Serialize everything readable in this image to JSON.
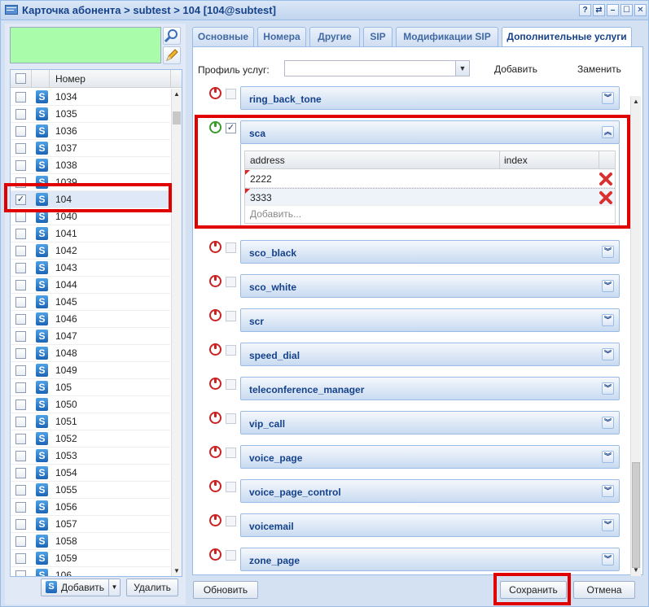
{
  "window": {
    "title": "Карточка абонента > subtest > 104 [104@subtest]",
    "controls": [
      "?",
      "⇄",
      "–",
      "☐",
      "✕"
    ]
  },
  "left": {
    "header_label": "Номер",
    "rows": [
      {
        "num": "1034",
        "checked": false
      },
      {
        "num": "1035",
        "checked": false
      },
      {
        "num": "1036",
        "checked": false
      },
      {
        "num": "1037",
        "checked": false
      },
      {
        "num": "1038",
        "checked": false
      },
      {
        "num": "1039",
        "checked": false
      },
      {
        "num": "104",
        "checked": true
      },
      {
        "num": "1040",
        "checked": false
      },
      {
        "num": "1041",
        "checked": false
      },
      {
        "num": "1042",
        "checked": false
      },
      {
        "num": "1043",
        "checked": false
      },
      {
        "num": "1044",
        "checked": false
      },
      {
        "num": "1045",
        "checked": false
      },
      {
        "num": "1046",
        "checked": false
      },
      {
        "num": "1047",
        "checked": false
      },
      {
        "num": "1048",
        "checked": false
      },
      {
        "num": "1049",
        "checked": false
      },
      {
        "num": "105",
        "checked": false
      },
      {
        "num": "1050",
        "checked": false
      },
      {
        "num": "1051",
        "checked": false
      },
      {
        "num": "1052",
        "checked": false
      },
      {
        "num": "1053",
        "checked": false
      },
      {
        "num": "1054",
        "checked": false
      },
      {
        "num": "1055",
        "checked": false
      },
      {
        "num": "1056",
        "checked": false
      },
      {
        "num": "1057",
        "checked": false
      },
      {
        "num": "1058",
        "checked": false
      },
      {
        "num": "1059",
        "checked": false
      },
      {
        "num": "106",
        "checked": false
      }
    ],
    "add_label": "Добавить",
    "delete_label": "Удалить"
  },
  "tabs": [
    {
      "label": "Основные",
      "active": false
    },
    {
      "label": "Номера",
      "active": false
    },
    {
      "label": "Другие",
      "active": false
    },
    {
      "label": "SIP",
      "active": false
    },
    {
      "label": "Модификации SIP",
      "active": false
    },
    {
      "label": "Дополнительные услуги",
      "active": true
    }
  ],
  "profile": {
    "label": "Профиль услуг:",
    "value": "",
    "add_label": "Добавить",
    "replace_label": "Заменить"
  },
  "services": [
    {
      "name": "ring_back_tone",
      "enabled": false,
      "checked": false,
      "expanded": false
    },
    {
      "name": "sca",
      "enabled": true,
      "checked": true,
      "expanded": true
    },
    {
      "name": "sco_black",
      "enabled": false,
      "checked": false,
      "expanded": false
    },
    {
      "name": "sco_white",
      "enabled": false,
      "checked": false,
      "expanded": false
    },
    {
      "name": "scr",
      "enabled": false,
      "checked": false,
      "expanded": false
    },
    {
      "name": "speed_dial",
      "enabled": false,
      "checked": false,
      "expanded": false
    },
    {
      "name": "teleconference_manager",
      "enabled": false,
      "checked": false,
      "expanded": false
    },
    {
      "name": "vip_call",
      "enabled": false,
      "checked": false,
      "expanded": false
    },
    {
      "name": "voice_page",
      "enabled": false,
      "checked": false,
      "expanded": false
    },
    {
      "name": "voice_page_control",
      "enabled": false,
      "checked": false,
      "expanded": false
    },
    {
      "name": "voicemail",
      "enabled": false,
      "checked": false,
      "expanded": false
    },
    {
      "name": "zone_page",
      "enabled": false,
      "checked": false,
      "expanded": false
    }
  ],
  "sca_grid": {
    "col_address": "address",
    "col_index": "index",
    "rows": [
      {
        "address": "2222",
        "index": ""
      },
      {
        "address": "3333",
        "index": ""
      }
    ],
    "add_hint": "Добавить..."
  },
  "footer": {
    "refresh_label": "Обновить",
    "save_label": "Сохранить",
    "cancel_label": "Отмена"
  },
  "colors": {
    "accent": "#15428b",
    "highlight": "#e00000",
    "search_bg": "#a9fca9"
  }
}
